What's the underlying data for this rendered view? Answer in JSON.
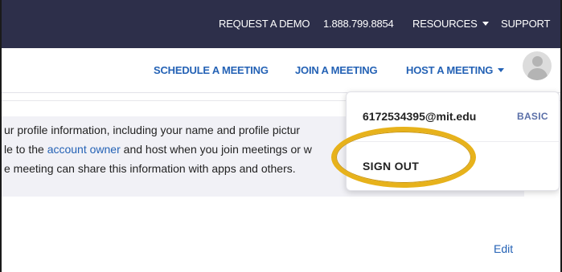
{
  "topbar": {
    "request_demo": "REQUEST A DEMO",
    "phone": "1.888.799.8854",
    "resources": "RESOURCES",
    "support": "SUPPORT"
  },
  "subnav": {
    "schedule": "SCHEDULE A MEETING",
    "join": "JOIN A MEETING",
    "host": "HOST A MEETING"
  },
  "info": {
    "line1": "ur profile information, including your name and profile pictur",
    "line2_pre": "le to the ",
    "line2_link": "account owner",
    "line2_post": " and host when you join meetings or w",
    "line3": "e meeting can share this information with apps and others."
  },
  "edit_label": "Edit",
  "dropdown": {
    "email": "6172534395@mit.edu",
    "plan": "BASIC",
    "sign_out": "SIGN OUT"
  },
  "colors": {
    "topbar_bg": "#2d2f4a",
    "link_blue": "#2462b5",
    "highlight_yellow": "#e7b21b"
  }
}
